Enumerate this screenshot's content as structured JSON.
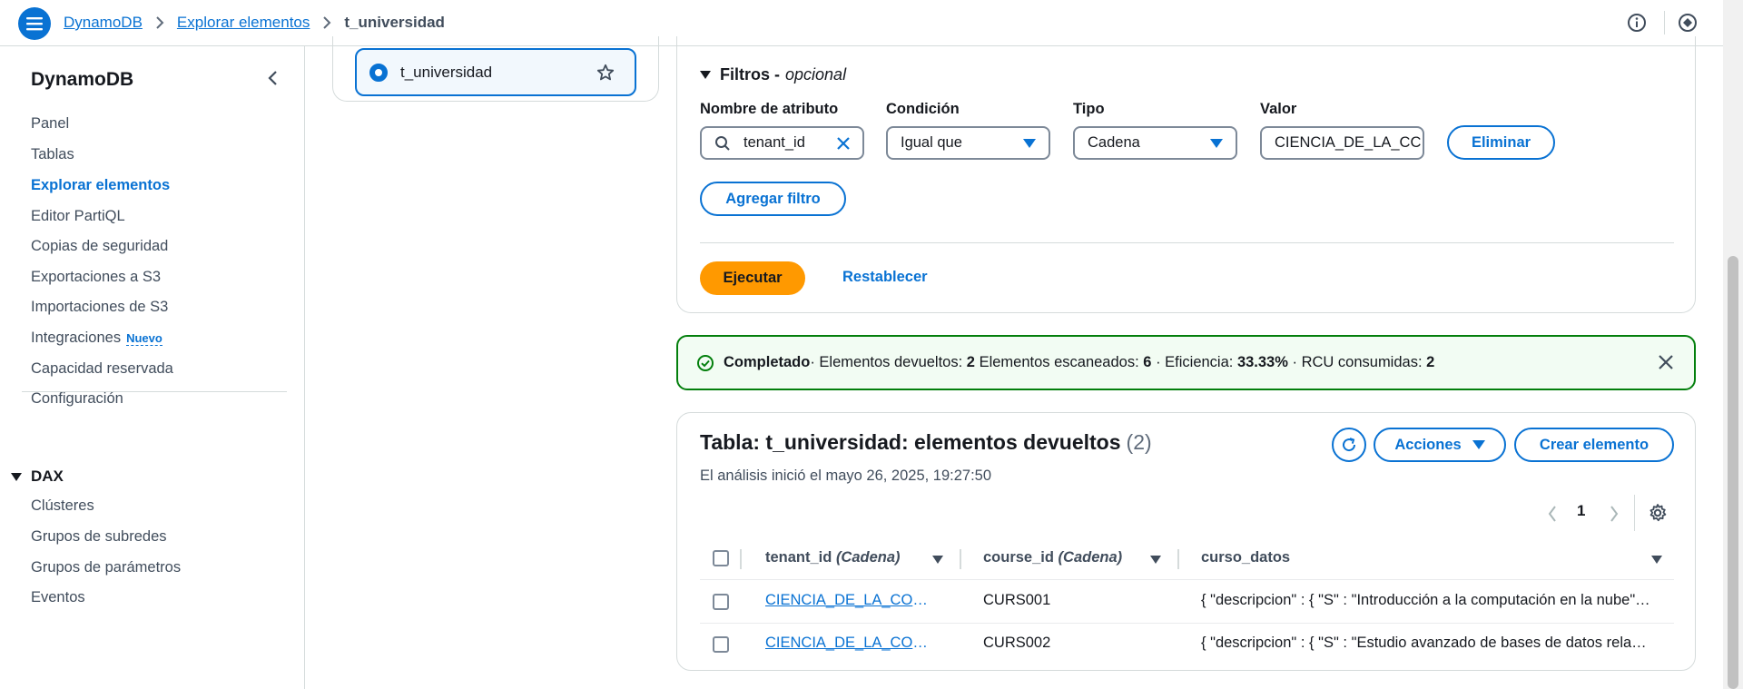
{
  "breadcrumb": {
    "items": [
      "DynamoDB",
      "Explorar elementos"
    ],
    "current": "t_universidad"
  },
  "sidebar": {
    "title": "DynamoDB",
    "items": [
      {
        "label": "Panel"
      },
      {
        "label": "Tablas"
      },
      {
        "label": "Explorar elementos"
      },
      {
        "label": "Editor PartiQL"
      },
      {
        "label": "Copias de seguridad"
      },
      {
        "label": "Exportaciones a S3"
      },
      {
        "label": "Importaciones de S3"
      },
      {
        "label": "Integraciones",
        "badge": "Nuevo"
      },
      {
        "label": "Capacidad reservada"
      },
      {
        "label": "Configuración"
      }
    ],
    "dax": {
      "title": "DAX",
      "items": [
        {
          "label": "Clústeres"
        },
        {
          "label": "Grupos de subredes"
        },
        {
          "label": "Grupos de parámetros"
        },
        {
          "label": "Eventos"
        }
      ]
    }
  },
  "tables_panel": {
    "selected_table": "t_universidad"
  },
  "filters": {
    "title": "Filtros",
    "optional": "opcional",
    "labels": {
      "attribute": "Nombre de atributo",
      "condition": "Condición",
      "type": "Tipo",
      "value": "Valor"
    },
    "attribute_value": "tenant_id",
    "condition_value": "Igual que",
    "type_value": "Cadena",
    "value_value": "CIENCIA_DE_LA_CC",
    "remove_label": "Eliminar",
    "add_filter_label": "Agregar filtro",
    "run_label": "Ejecutar",
    "reset_label": "Restablecer"
  },
  "alert": {
    "status": "Completado",
    "returned_label": "· Elementos devueltos:",
    "returned": "2",
    "scanned_label": "Elementos escaneados:",
    "scanned": "6",
    "efficiency_label": "· Eficiencia:",
    "efficiency": "33.33%",
    "rcu_label": "· RCU consumidas:",
    "rcu": "2"
  },
  "results": {
    "title": "Tabla: t_universidad: elementos devueltos",
    "count": "(2)",
    "subtitle": "El análisis inició el mayo 26, 2025, 19:27:50",
    "actions_label": "Acciones",
    "create_label": "Crear elemento",
    "page": "1",
    "columns": [
      {
        "name": "tenant_id",
        "type": "(Cadena)"
      },
      {
        "name": "course_id",
        "type": "(Cadena)"
      },
      {
        "name": "curso_datos",
        "type": ""
      }
    ],
    "rows": [
      {
        "tenant_id": "CIENCIA_DE_LA_COMPUTACION",
        "course_id": "CURS001",
        "curso_datos": "{ \"descripcion\" : { \"S\" : \"Introducción a la computación en la nube\" } }"
      },
      {
        "tenant_id": "CIENCIA_DE_LA_COMPUTACION",
        "course_id": "CURS002",
        "curso_datos": "{ \"descripcion\" : { \"S\" : \"Estudio avanzado de bases de datos relacionales\" } }"
      }
    ]
  }
}
